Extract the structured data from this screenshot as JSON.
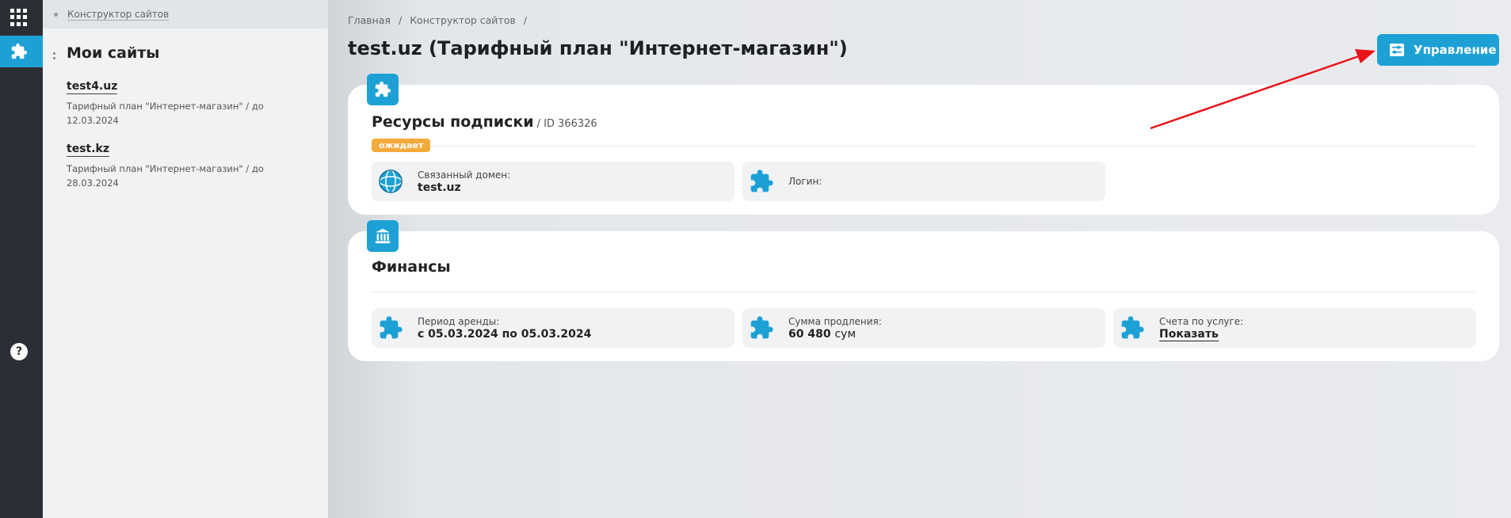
{
  "rail": {
    "apps_icon": "apps-grid-icon",
    "active_icon": "puzzle-icon",
    "help_icon": "help-icon",
    "help_label": "?"
  },
  "sidebar": {
    "breadcrumb": "Конструктор сайтов",
    "title": "Мои сайты",
    "sites": [
      {
        "name": "test4.uz",
        "desc": "Тарифный план \"Интернет-магазин\" / до 12.03.2024"
      },
      {
        "name": "test.kz",
        "desc": "Тарифный план \"Интернет-магазин\" / до 28.03.2024"
      }
    ]
  },
  "main": {
    "breadcrumbs": [
      "Главная",
      "/",
      "Конструктор сайтов",
      "/"
    ],
    "title": "test.uz (Тарифный план \"Интернет-магазин\")",
    "manage_button": "Управление",
    "subscription": {
      "title": "Ресурсы подписки",
      "id_label": "/ ID 366326",
      "status": "ожидает",
      "domain_label": "Связанный домен:",
      "domain_value": "test.uz",
      "login_label": "Логин:"
    },
    "finance": {
      "title": "Финансы",
      "period_label": "Период аренды:",
      "period_value": "с 05.03.2024 по 05.03.2024",
      "renewal_label": "Сумма продления:",
      "renewal_value": "60 480",
      "renewal_unit": "сум",
      "invoices_label": "Счета по услуге:",
      "invoices_link": "Показать"
    }
  },
  "colors": {
    "accent": "#1da1d5",
    "badge": "#f4a93b",
    "rail": "#2b2e34",
    "arrow": "#e8141a"
  }
}
